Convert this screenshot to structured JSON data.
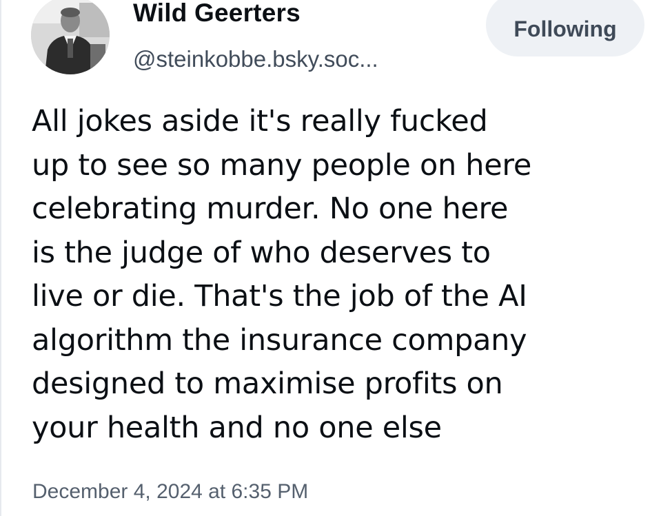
{
  "author": {
    "display_name": "Wild Geerters",
    "handle": "@steinkobbe.bsky.soc...",
    "avatar_icon": "user-avatar-photo"
  },
  "follow_button": {
    "label": "Following"
  },
  "post": {
    "text_lines": [
      "All jokes aside it's really fucked",
      "up to see so many people on here",
      "celebrating murder. No one here",
      "is the judge of who deserves to",
      "live or die. That's the job of the AI",
      "algorithm the insurance company",
      "designed to maximise profits on",
      "your health and no one else"
    ],
    "timestamp": "December 4, 2024 at 6:35 PM"
  },
  "colors": {
    "button_bg": "#eef1f5",
    "button_text": "#3f4a58",
    "handle_text": "#414c5a",
    "timestamp_text": "#55606e",
    "body_text": "#0b0f14"
  }
}
